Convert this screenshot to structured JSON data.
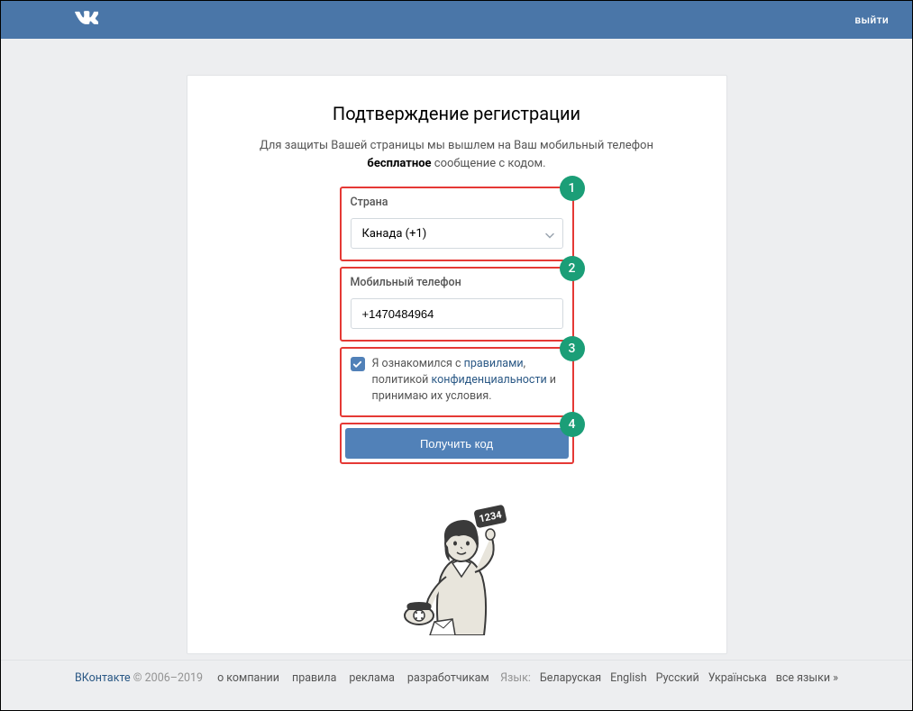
{
  "header": {
    "logout_label": "выйти"
  },
  "page": {
    "title": "Подтверждение регистрации",
    "subtitle_before": "Для защиты Вашей страницы мы вышлем на Ваш мобильный телефон ",
    "subtitle_bold": "бесплатное",
    "subtitle_after": " сообщение с кодом."
  },
  "form": {
    "badges": {
      "b1": "1",
      "b2": "2",
      "b3": "3",
      "b4": "4"
    },
    "country": {
      "label": "Страна",
      "value": "Канада (+1)"
    },
    "phone": {
      "label": "Мобильный телефон",
      "prefix": "+1",
      "value": "+1470484964"
    },
    "terms": {
      "prefix": "Я ознакомился с ",
      "rules": "правилами",
      "middle": ", политикой ",
      "privacy": "конфиденциальности",
      "suffix": " и принимаю их условия."
    },
    "submit_label": "Получить код"
  },
  "illustration": {
    "code_bubble": "1234"
  },
  "footer": {
    "brand": "ВКонтакте",
    "years": " © 2006–2019",
    "links": {
      "about": "о компании",
      "rules": "правила",
      "ads": "реклама",
      "devs": "разработчикам"
    },
    "lang_label": "Язык:",
    "langs": {
      "be": "Беларуская",
      "en": "English",
      "ru": "Русский",
      "uk": "Українська",
      "all": "все языки »"
    }
  }
}
